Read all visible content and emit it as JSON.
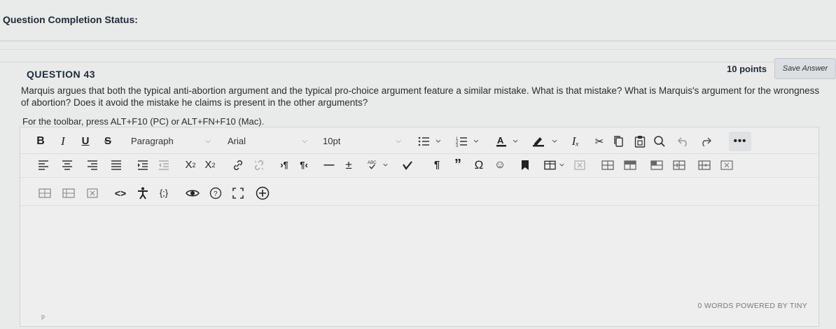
{
  "status_label": "Question Completion Status:",
  "question": {
    "number_label": "QUESTION 43",
    "points": "10 points",
    "save_label": "Save Answer",
    "text": "Marquis argues that both the typical anti-abortion argument and the typical pro-choice argument feature a similar mistake. What is that mistake? What is Marquis's argument for the wrongness of abortion? Does it avoid the mistake he claims is present in the other arguments?",
    "toolbar_hint": "For the toolbar, press ALT+F10 (PC) or ALT+FN+F10 (Mac)."
  },
  "editor": {
    "format_select": "Paragraph",
    "font_select": "Arial",
    "size_select": "10pt",
    "footer": "0 WORDS  POWERED BY TINY",
    "path": "p",
    "icons": {
      "row1": [
        "bold-icon",
        "italic-icon",
        "underline-icon",
        "strikethrough-icon",
        "bullet-list-icon",
        "numbered-list-icon",
        "text-color-icon",
        "highlight-icon",
        "clear-formatting-icon",
        "cut-icon",
        "copy-icon",
        "paste-icon",
        "find-icon",
        "undo-icon",
        "redo-icon",
        "more-icon"
      ],
      "row2": [
        "align-left-icon",
        "align-center-icon",
        "align-right-icon",
        "justify-icon",
        "indent-icon",
        "outdent-icon",
        "superscript-icon",
        "subscript-icon",
        "link-icon",
        "unlink-icon",
        "ltr-icon",
        "rtl-icon",
        "horizontal-line-icon",
        "plus-minus-icon",
        "spellcheck-icon",
        "check-icon",
        "paragraph-mark-icon",
        "blockquote-icon",
        "omega-icon",
        "emoticon-icon",
        "bookmark-icon",
        "table-icon",
        "table-delete-icon",
        "table-row-before-icon",
        "table-row-after-icon",
        "table-col-before-icon",
        "table-split-icon",
        "table-merge-icon",
        "table-props-icon"
      ],
      "row3": [
        "table-insert-row-icon",
        "table-insert-col-icon",
        "table-remove-icon",
        "code-icon",
        "accessibility-icon",
        "code-sample-icon",
        "preview-icon",
        "help-icon",
        "fullscreen-icon",
        "add-content-icon"
      ]
    }
  }
}
